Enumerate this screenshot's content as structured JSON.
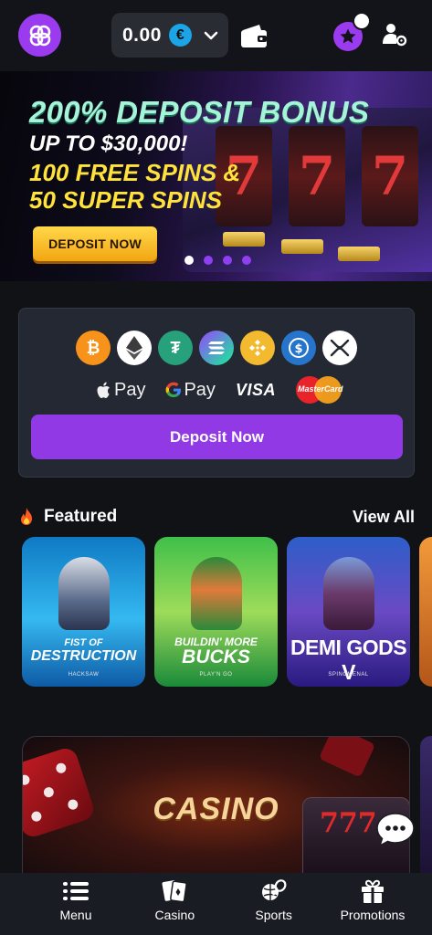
{
  "header": {
    "balance": "0.00",
    "currency_symbol": "€"
  },
  "banner": {
    "line1": "200% DEPOSIT BONUS",
    "line2": "UP TO $30,000!",
    "line3": "100 FREE SPINS &",
    "line4": "50 SUPER SPINS",
    "button": "DEPOSIT NOW",
    "slides_total": 4,
    "slide_active": 1
  },
  "payments": {
    "crypto_icons": [
      "bitcoin-icon",
      "ethereum-icon",
      "tether-icon",
      "solana-icon",
      "bnb-icon",
      "usdc-icon",
      "xrp-icon"
    ],
    "apple_pay": "Pay",
    "google_pay": "Pay",
    "visa": "VISA",
    "mastercard": "MasterCard",
    "deposit_button": "Deposit Now"
  },
  "featured": {
    "title": "Featured",
    "view_all": "View All",
    "games": [
      {
        "title": "FIST OF DESTRUCTION",
        "title_top": "FIST OF",
        "title_main": "DESTRUCTION",
        "provider": "HACKSAW"
      },
      {
        "title": "BUILDIN' MORE BUCKS",
        "title_top": "BUILDIN' MORE",
        "title_main": "BUCKS",
        "provider": "PLAY'N GO"
      },
      {
        "title": "DEMI GODS V",
        "title_top": "",
        "title_main": "DEMI GODS V",
        "provider": "SPINOMENAL"
      }
    ]
  },
  "promo": {
    "title": "CASINO",
    "slot_text": "777"
  },
  "bottom_nav": {
    "items": [
      {
        "label": "Menu",
        "icon": "menu-icon"
      },
      {
        "label": "Casino",
        "icon": "cards-icon"
      },
      {
        "label": "Sports",
        "icon": "sports-icon"
      },
      {
        "label": "Promotions",
        "icon": "gift-icon"
      }
    ]
  },
  "colors": {
    "accent": "#9239e6",
    "background": "#111216",
    "card": "#232833"
  }
}
